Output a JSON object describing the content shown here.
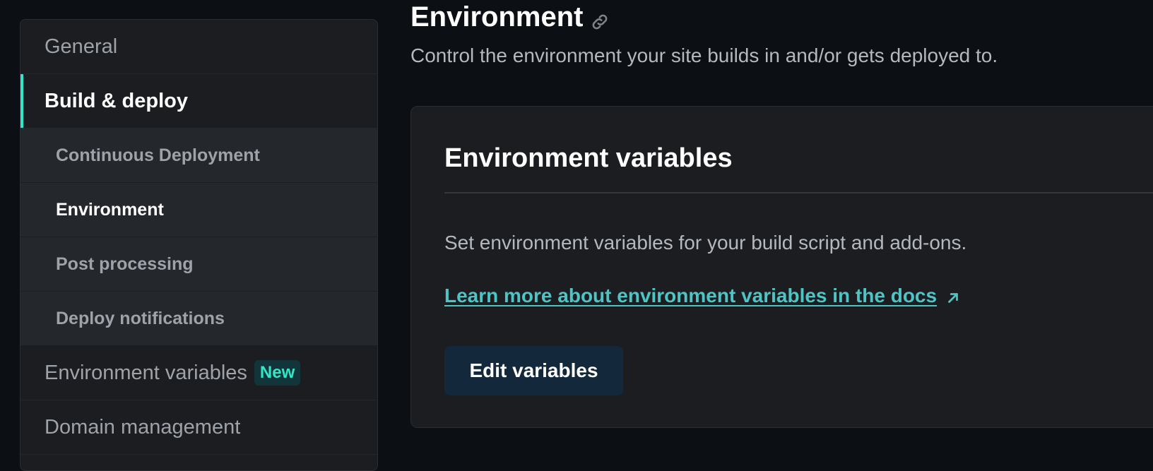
{
  "sidebar": {
    "items": [
      {
        "label": "General"
      },
      {
        "label": "Build & deploy"
      },
      {
        "label": "Environment variables",
        "badge": "New"
      },
      {
        "label": "Domain management"
      }
    ],
    "subitems": [
      {
        "label": "Continuous Deployment"
      },
      {
        "label": "Environment"
      },
      {
        "label": "Post processing"
      },
      {
        "label": "Deploy notifications"
      }
    ]
  },
  "main": {
    "title": "Environment",
    "description": "Control the environment your site builds in and/or gets deployed to.",
    "card": {
      "title": "Environment variables",
      "text": "Set environment variables for your build script and add-ons.",
      "link_label": "Learn more about environment variables in the docs",
      "button_label": "Edit variables"
    }
  },
  "colors": {
    "accent": "#32e6c7",
    "link": "#4fc4c4",
    "background": "#0c0f13",
    "panel": "#1b1d21"
  },
  "icons": {
    "title_anchor": "link-icon",
    "external_link": "external-link-arrow-icon"
  }
}
